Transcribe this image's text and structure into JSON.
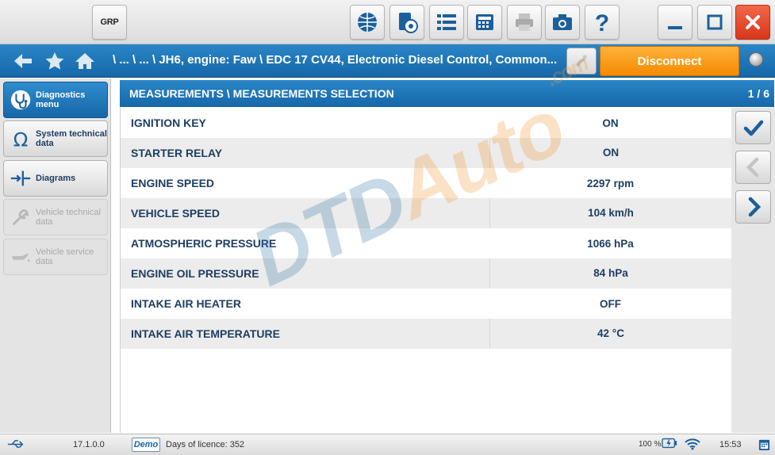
{
  "toolbar": {
    "grp_label": "GRP",
    "buttons": [
      "web-icon",
      "view-eye-icon",
      "list-icon",
      "calculator-icon",
      "printer-icon",
      "camera-icon",
      "help-icon"
    ],
    "window": [
      "minimize-icon",
      "maximize-icon",
      "close-icon"
    ]
  },
  "nav": {
    "breadcrumb": "\\ ... \\ ... \\ JH6, engine: Faw \\ EDC 17 CV44, Electronic Diesel Control, Common...",
    "disconnect_label": "Disconnect"
  },
  "sidebar": {
    "items": [
      {
        "label": "Diagnostics menu",
        "icon": "stethoscope-icon",
        "state": "active"
      },
      {
        "label": "System technical data",
        "icon": "omega-icon",
        "state": "normal"
      },
      {
        "label": "Diagrams",
        "icon": "diagram-icon",
        "state": "normal"
      },
      {
        "label": "Vehicle technical data",
        "icon": "wrench-icon",
        "state": "disabled"
      },
      {
        "label": "Vehicle service data",
        "icon": "oilcan-icon",
        "state": "disabled"
      }
    ]
  },
  "content": {
    "title": "MEASUREMENTS \\ MEASUREMENTS SELECTION",
    "pager": "1 / 6",
    "rows": [
      {
        "name": "IGNITION KEY",
        "value": "ON"
      },
      {
        "name": "STARTER RELAY",
        "value": "ON"
      },
      {
        "name": "ENGINE SPEED",
        "value": "2297 rpm"
      },
      {
        "name": "VEHICLE SPEED",
        "value": "104 km/h"
      },
      {
        "name": "ATMOSPHERIC PRESSURE",
        "value": "1066 hPa"
      },
      {
        "name": "ENGINE OIL PRESSURE",
        "value": "84 hPa"
      },
      {
        "name": "INTAKE AIR HEATER",
        "value": "OFF"
      },
      {
        "name": "INTAKE AIR TEMPERATURE",
        "value": "42 °C"
      }
    ]
  },
  "watermark": {
    "part1": "DTD",
    "part2": "Auto",
    "part3": ".com"
  },
  "statusbar": {
    "version": "17.1.0.0",
    "demo": "Demo",
    "licence": "Days of licence: 352",
    "battery": "100 %",
    "time": "15:53"
  },
  "colors": {
    "accent_blue": "#1b74b8",
    "disconnect_orange": "#f7941d",
    "close_red": "#e5472b",
    "text_dark_blue": "#1d3e63"
  }
}
